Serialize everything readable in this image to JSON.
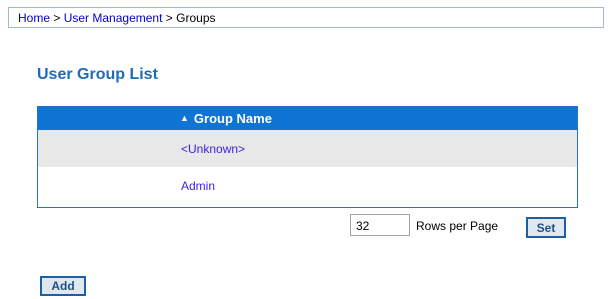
{
  "breadcrumb": {
    "home": "Home",
    "separator": ">",
    "section": "User Management",
    "current": "Groups"
  },
  "page": {
    "title": "User Group List"
  },
  "table": {
    "header": {
      "label": "Group Name",
      "sort_icon": "sort-asc-icon",
      "sort_glyph": "▲"
    },
    "rows": [
      {
        "name": "<Unknown>"
      },
      {
        "name": "Admin"
      }
    ]
  },
  "pagination": {
    "rows_per_page_value": "32",
    "rows_per_page_label": "Rows per Page",
    "set_label": "Set"
  },
  "actions": {
    "add_label": "Add"
  },
  "colors": {
    "accent": "#0f74d4",
    "title": "#1f6cb3",
    "link": "#3a1fe0"
  }
}
